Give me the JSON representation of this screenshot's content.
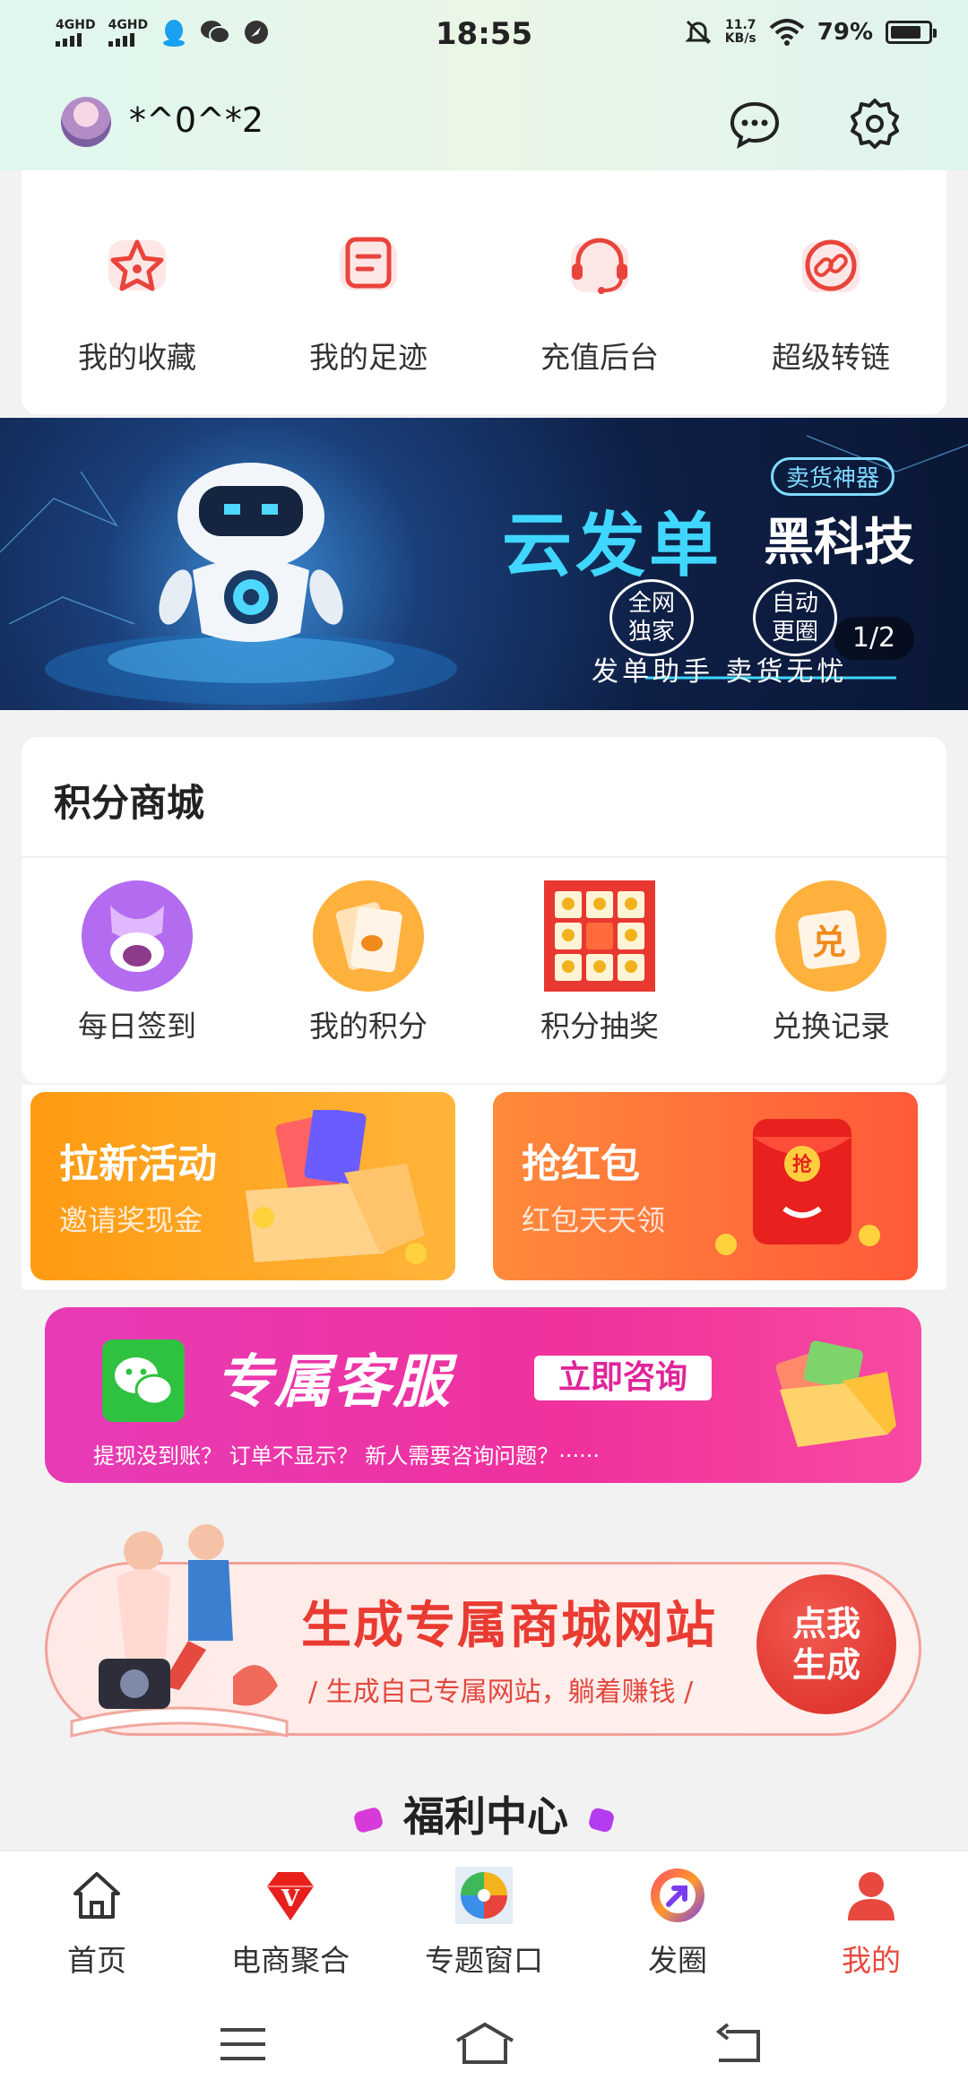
{
  "status_bar": {
    "time": "18:55",
    "signal1": "4GHD",
    "signal2": "4GHD",
    "net_speed_value": "11.7",
    "net_speed_unit": "KB/s",
    "battery": "79%"
  },
  "header": {
    "username": "*^0^*2"
  },
  "quick_links": [
    {
      "label": "我的收藏",
      "icon": "star-icon"
    },
    {
      "label": "我的足迹",
      "icon": "footprint-icon"
    },
    {
      "label": "充值后台",
      "icon": "headset-icon"
    },
    {
      "label": "超级转链",
      "icon": "link-icon"
    }
  ],
  "banner": {
    "tag": "卖货神器",
    "title": "云发单",
    "title2": "黑科技",
    "bubble1_line1": "全网",
    "bubble1_line2": "独家",
    "bubble2_line1": "自动",
    "bubble2_line2": "更圈",
    "subtitle": "发单助手 卖货无忧",
    "page_indicator": "1/2"
  },
  "points_mall": {
    "title": "积分商城",
    "items": [
      {
        "label": "每日签到",
        "icon": "bean-icon"
      },
      {
        "label": "我的积分",
        "icon": "points-card-icon"
      },
      {
        "label": "积分抽奖",
        "icon": "lottery-grid-icon"
      },
      {
        "label": "兑换记录",
        "icon": "exchange-icon"
      }
    ]
  },
  "promos": [
    {
      "title": "拉新活动",
      "subtitle": "邀请奖现金"
    },
    {
      "title": "抢红包",
      "subtitle": "红包天天领",
      "badge": "抢"
    }
  ],
  "service_banner": {
    "title": "专属客服",
    "button": "立即咨询",
    "questions": "提现没到账？  订单不显示？  新人需要咨询问题？······"
  },
  "website_banner": {
    "title": "生成专属商城网站",
    "subtitle": "/ 生成自己专属网站，躺着赚钱 /",
    "button_line1": "点我",
    "button_line2": "生成"
  },
  "welfare_title": "福利中心",
  "tabs": [
    {
      "label": "首页",
      "icon": "home-icon"
    },
    {
      "label": "电商聚合",
      "icon": "diamond-v-icon"
    },
    {
      "label": "专题窗口",
      "icon": "pinwheel-icon"
    },
    {
      "label": "发圈",
      "icon": "share-arrow-icon"
    },
    {
      "label": "我的",
      "icon": "person-icon",
      "active": true
    }
  ],
  "colors": {
    "accent_red": "#ea3b32",
    "active_tab": "#e8493f",
    "service_pink": "#ec33a8",
    "promo_orange": "#ff9a12"
  }
}
